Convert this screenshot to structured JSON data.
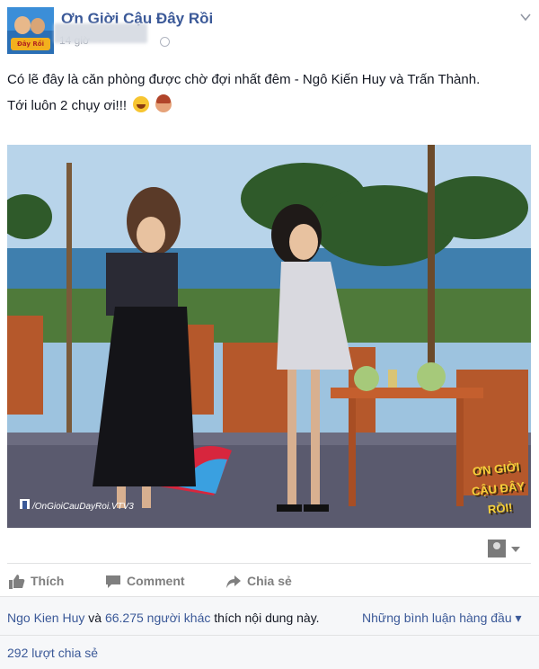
{
  "post": {
    "page_name": "Ơn Giời Cậu Đây Rồi",
    "timestamp": "14 giờ",
    "avatar_logo_text": "Đây Rồi",
    "text_lines": [
      "Có lẽ đây là căn phòng được chờ đợi nhất đêm - Ngô Kiến Huy và Trấn Thành.",
      "Tới luôn 2 chụy ơi!!!"
    ],
    "emoji_icons": [
      "laughing-tears-emoji-icon",
      "woman-gesture-emoji-icon"
    ],
    "photo": {
      "watermark": "/OnGioiCauDayRoi.VTV3",
      "show_logo_line1": "ƠN GIỜI",
      "show_logo_line2": "CẬU ĐÂY RỒI!"
    }
  },
  "actions": {
    "like": "Thích",
    "comment": "Comment",
    "share": "Chia sẻ"
  },
  "footer": {
    "liker_name": "Ngo Kien Huy",
    "conjunction": " và ",
    "others_count": "66.275 người khác",
    "suffix": " thích nội dung này.",
    "comments_filter": "Những bình luận hàng đầu",
    "shares": "292 lượt chia sẻ"
  },
  "colors": {
    "link_blue": "#3b5998",
    "text_dark": "#141823",
    "muted_gray": "#7f7f7f",
    "footer_bg": "#f6f7f9"
  }
}
